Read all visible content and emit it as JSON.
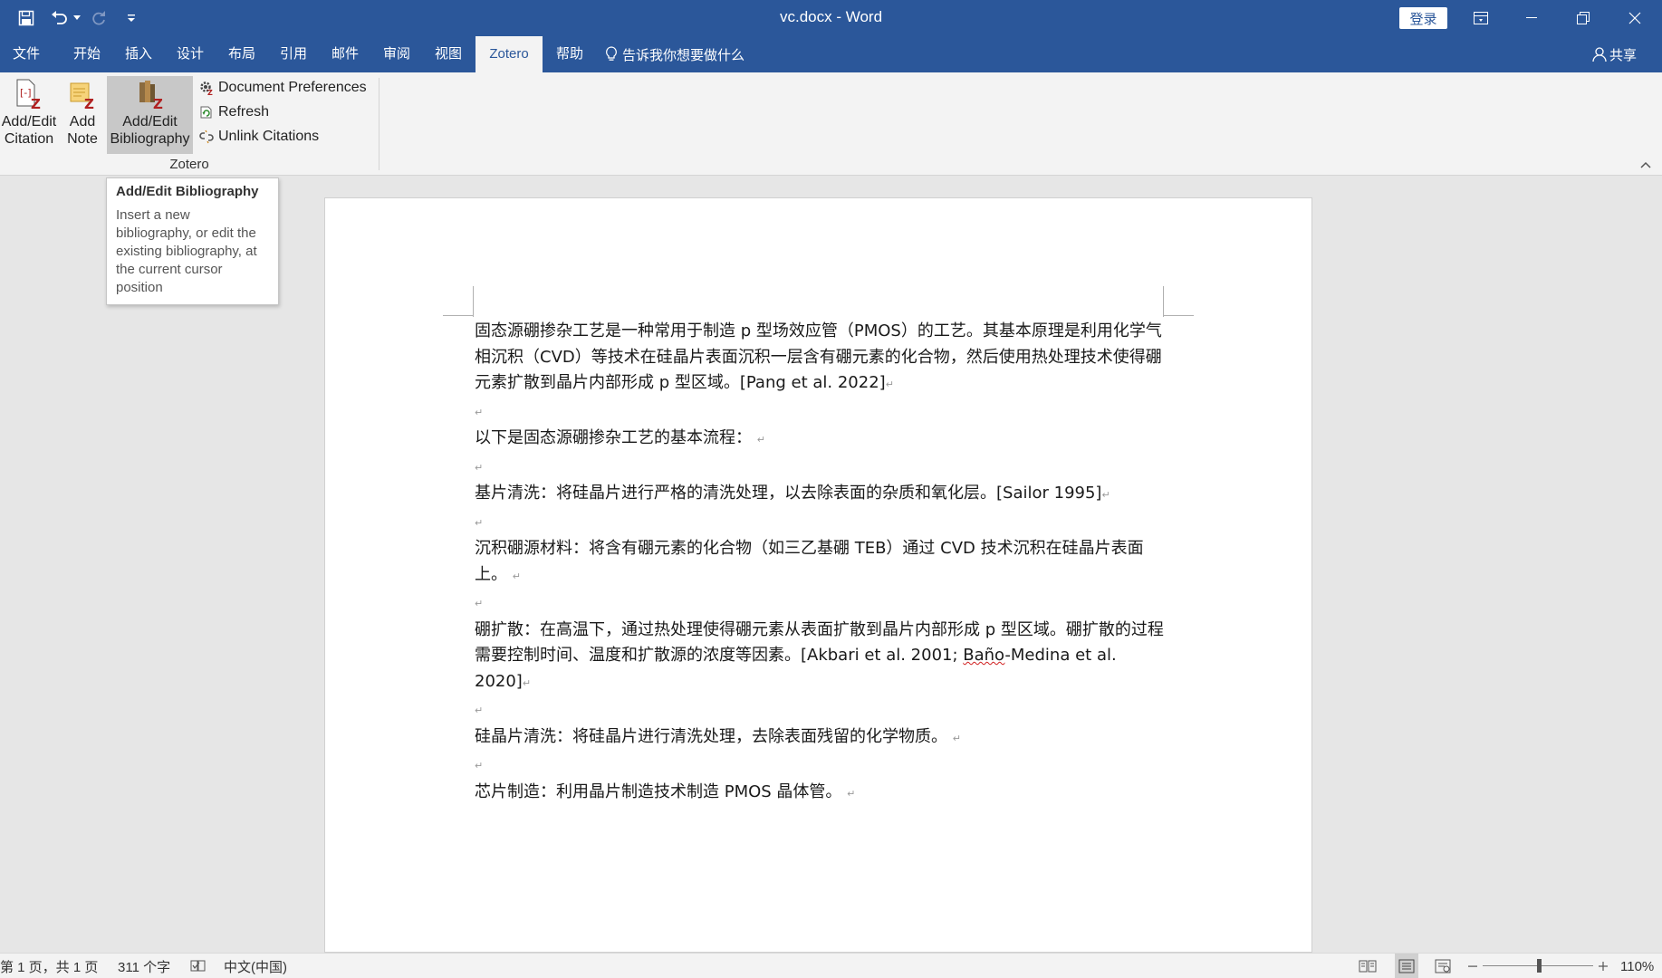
{
  "window": {
    "title": "vc.docx  -  Word",
    "login_label": "登录"
  },
  "tabs": [
    {
      "label": "文件"
    },
    {
      "label": "开始"
    },
    {
      "label": "插入"
    },
    {
      "label": "设计"
    },
    {
      "label": "布局"
    },
    {
      "label": "引用"
    },
    {
      "label": "邮件"
    },
    {
      "label": "审阅"
    },
    {
      "label": "视图"
    },
    {
      "label": "Zotero",
      "active": true
    },
    {
      "label": "帮助"
    }
  ],
  "tell_me": "告诉我你想要做什么",
  "share_label": "共享",
  "ribbon": {
    "group_label": "Zotero",
    "add_edit_citation": {
      "line1": "Add/Edit",
      "line2": "Citation"
    },
    "add_note": {
      "line1": "Add",
      "line2": "Note"
    },
    "add_edit_bibliography": {
      "line1": "Add/Edit",
      "line2": "Bibliography"
    },
    "document_preferences": "Document Preferences",
    "refresh": "Refresh",
    "unlink_citations": "Unlink Citations"
  },
  "tooltip": {
    "title": "Add/Edit Bibliography",
    "body": "Insert a new bibliography, or edit the existing bibliography, at the current cursor position"
  },
  "document": {
    "p1": "固态源硼掺杂工艺是一种常用于制造 p 型场效应管（PMOS）的工艺。其基本原理是利用化学气相沉积（CVD）等技术在硅晶片表面沉积一层含有硼元素的化合物，然后使用热处理技术使得硼元素扩散到晶片内部形成 p 型区域。[Pang et al. 2022]",
    "p2": "以下是固态源硼掺杂工艺的基本流程：",
    "p3": "基片清洗：将硅晶片进行严格的清洗处理，以去除表面的杂质和氧化层。[Sailor 1995]",
    "p4": "沉积硼源材料：将含有硼元素的化合物（如三乙基硼 TEB）通过 CVD 技术沉积在硅晶片表面上。",
    "p5_a": "硼扩散：在高温下，通过热处理使得硼元素从表面扩散到晶片内部形成 p 型区域。硼扩散的过程需要控制时间、温度和扩散源的浓度等因素。[Akbari et al. 2001; ",
    "p5_b": "Baño",
    "p5_c": "-Medina et al. 2020]",
    "p6": "硅晶片清洗：将硅晶片进行清洗处理，去除表面残留的化学物质。",
    "p7": "芯片制造：利用晶片制造技术制造 PMOS 晶体管。",
    "paragraph_mark": "↵"
  },
  "status": {
    "page": "第 1 页，共 1 页",
    "words": "311 个字",
    "language": "中文(中国)",
    "zoom": "110%",
    "zoom_level": 1.1
  }
}
